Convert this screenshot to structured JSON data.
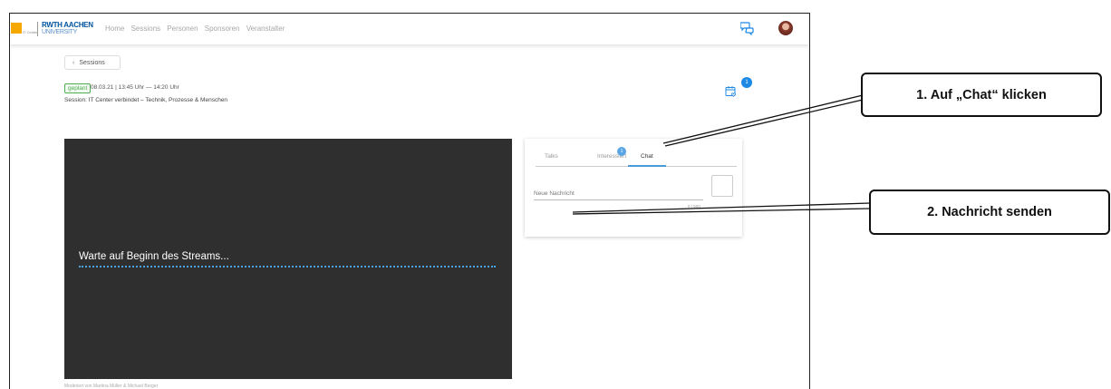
{
  "nav": {
    "logo_small_text": "IT Center",
    "logo_main": "RWTH AACHEN",
    "logo_sub": "UNIVERSITY",
    "items": [
      "Home",
      "Sessions",
      "Personen",
      "Sponsoren",
      "Veranstalter"
    ]
  },
  "back_button": {
    "label": "Sessions"
  },
  "session": {
    "status": "geplant",
    "time": "08.03.21 | 13:45 Uhr — 14:20 Uhr",
    "title": "Session: IT Center verbindet – Technik, Prozesse & Menschen",
    "calendar_badge_count": "1"
  },
  "video": {
    "waiting_text": "Warte auf Beginn des Streams...",
    "below_text": "Moderiert von Martina Müller & Michael Berger"
  },
  "chat_panel": {
    "tabs": [
      {
        "label": "Talks"
      },
      {
        "label": "Interessiert",
        "badge": "1"
      },
      {
        "label": "Chat",
        "active": true
      }
    ],
    "input_placeholder": "Neue Nachricht",
    "char_count": "0 / 500"
  },
  "callouts": {
    "step1": "1. Auf „Chat“ klicken",
    "step2": "2. Nachricht senden"
  },
  "colors": {
    "accent": "#1e88e5",
    "status_green": "#4caf50",
    "video_bg": "#2f2f2f",
    "logo_orange": "#f6a800"
  }
}
